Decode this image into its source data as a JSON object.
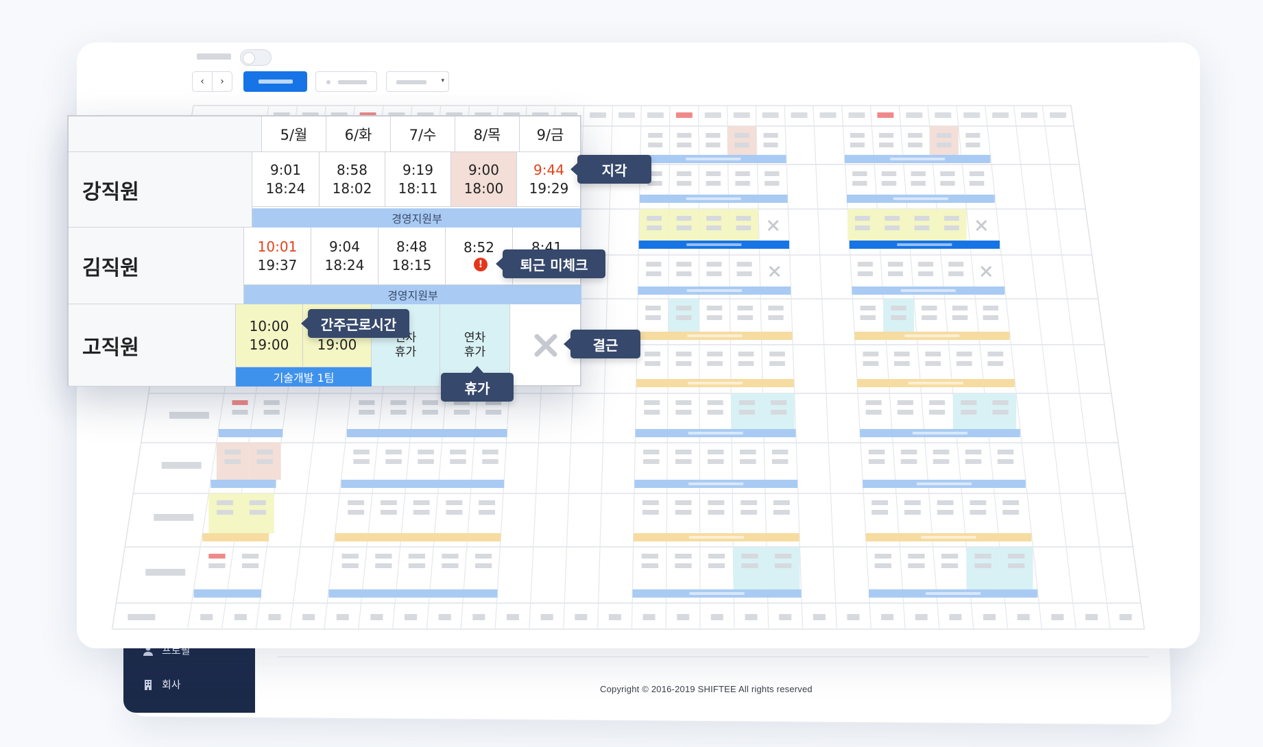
{
  "sidebar": {
    "items": [
      {
        "label": "프로필",
        "icon": "user-icon"
      },
      {
        "label": "회사",
        "icon": "building-icon"
      }
    ]
  },
  "footer": {
    "copyright": "Copyright © 2016-2019 SHIFTEE All rights reserved"
  },
  "toolbar": {
    "prev": "‹",
    "next": "›",
    "select_caret": "▾"
  },
  "zoom": {
    "days": [
      "5/월",
      "6/화",
      "7/수",
      "8/목",
      "9/금"
    ],
    "employees": [
      {
        "name": "강직원",
        "dept": "경영지원부",
        "cells": [
          {
            "in": "9:01",
            "out": "18:24"
          },
          {
            "in": "8:58",
            "out": "18:02"
          },
          {
            "in": "9:19",
            "out": "18:11"
          },
          {
            "in": "9:00",
            "out": "18:00"
          },
          {
            "in": "9:44",
            "out": "19:29"
          }
        ]
      },
      {
        "name": "김직원",
        "dept": "경영지원부",
        "cells": [
          {
            "in": "10:01",
            "out": "19:37"
          },
          {
            "in": "9:04",
            "out": "18:24"
          },
          {
            "in": "8:48",
            "out": "18:15"
          },
          {
            "in": "8:52",
            "out": ""
          },
          {
            "in": "8:41",
            "out": ""
          }
        ]
      },
      {
        "name": "고직원",
        "dept": "기술개발 1팀",
        "cells": [
          {
            "in": "10:00",
            "out": "19:00"
          },
          {
            "in": "",
            "out": "19:00"
          },
          {
            "in": "연차",
            "out": "휴가"
          },
          {
            "in": "연차",
            "out": "휴가"
          },
          {
            "in": "",
            "out": ""
          }
        ]
      }
    ],
    "alert_mark": "!"
  },
  "callouts": {
    "late": "지각",
    "missing_checkout": "퇴근 미체크",
    "deemed_hours": "간주근로시간",
    "absence": "결근",
    "leave": "휴가"
  },
  "colors": {
    "primary": "#1674e6",
    "dept_blue": "#a9cbf3",
    "dept_yellow": "#f6dca0",
    "late_red": "#e0421b",
    "late_cell": "#f3ded8",
    "deemed_cell": "#f4f6c4",
    "leave_cell": "#d8f1f4",
    "callout": "#36486b",
    "sidebar": "#1c2a4a"
  }
}
